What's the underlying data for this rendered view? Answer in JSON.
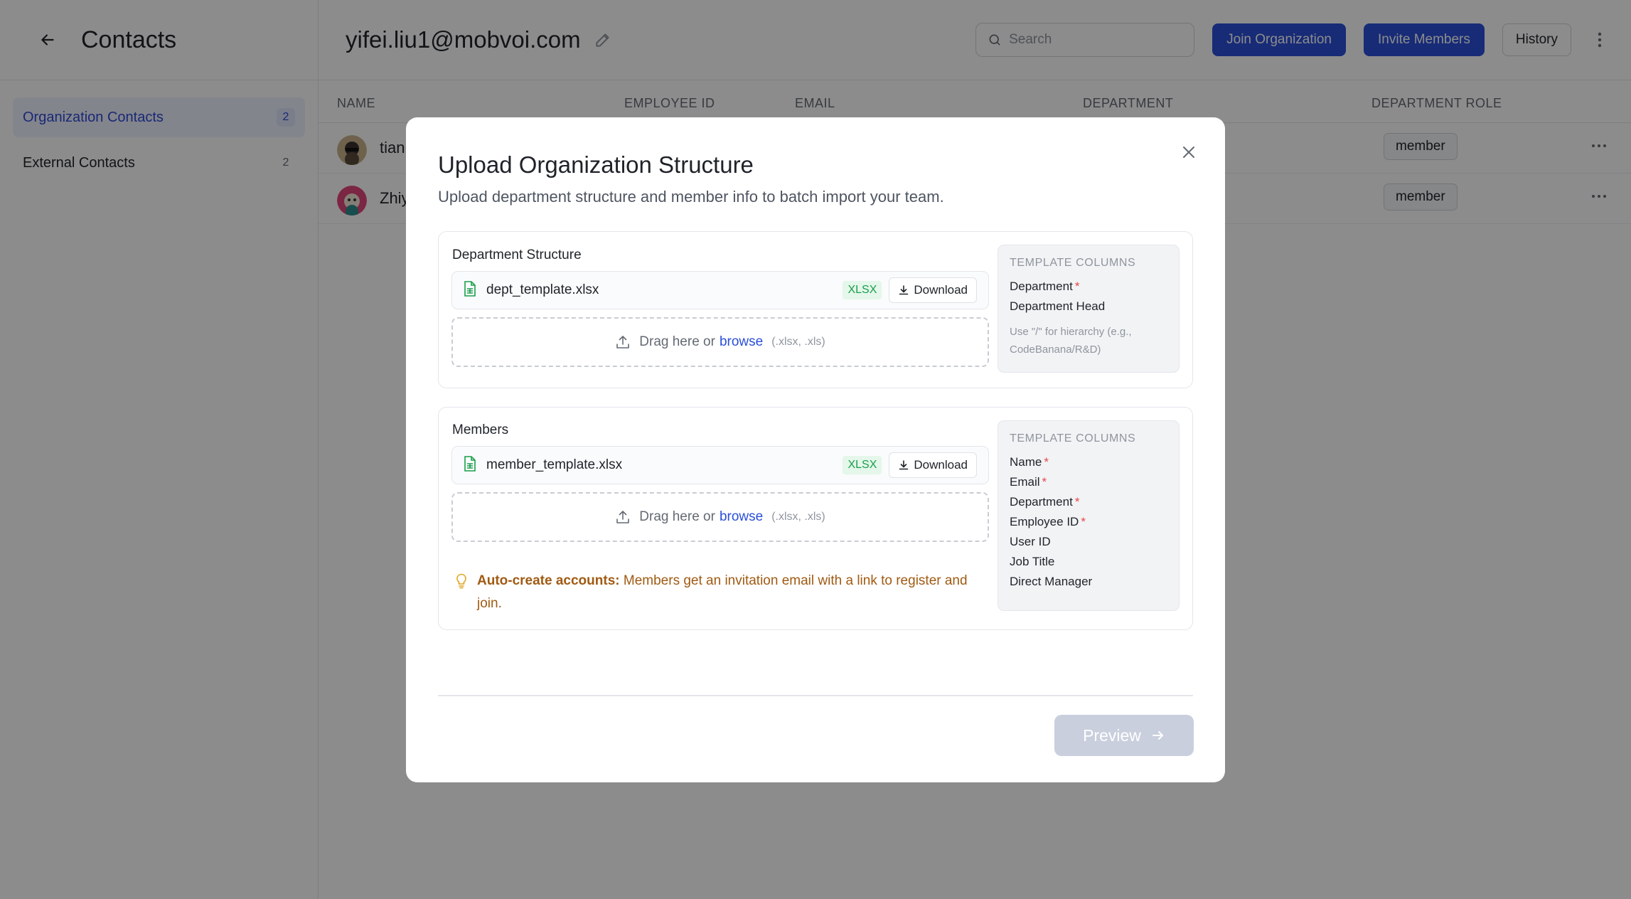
{
  "sidebar": {
    "title": "Contacts",
    "items": [
      {
        "label": "Organization Contacts",
        "count": "2",
        "active": true
      },
      {
        "label": "External Contacts",
        "count": "2",
        "active": false
      }
    ]
  },
  "header": {
    "org_name": "yifei.liu1@mobvoi.com",
    "search_placeholder": "Search",
    "join_label": "Join Organization",
    "invite_label": "Invite Members",
    "history_label": "History"
  },
  "table": {
    "columns": [
      "NAME",
      "EMPLOYEE ID",
      "EMAIL",
      "DEPARTMENT",
      "DEPARTMENT ROLE"
    ],
    "rows": [
      {
        "name": "tian",
        "role": "member"
      },
      {
        "name": "Zhiy",
        "role": "member"
      }
    ]
  },
  "modal": {
    "title": "Upload Organization Structure",
    "subtitle": "Upload department structure and member info to batch import your team.",
    "department": {
      "title": "Department Structure",
      "file_name": "dept_template.xlsx",
      "badge": "XLSX",
      "download_label": "Download",
      "dropzone_text": "Drag here or",
      "dropzone_browse": "browse",
      "dropzone_ext": "(.xlsx, .xls)",
      "columns_title": "TEMPLATE COLUMNS",
      "columns": [
        {
          "label": "Department",
          "required": "*"
        },
        {
          "label": "Department Head",
          "required": ""
        }
      ],
      "note": "Use \"/\" for hierarchy (e.g., CodeBanana/R&D)"
    },
    "members": {
      "title": "Members",
      "file_name": "member_template.xlsx",
      "badge": "XLSX",
      "download_label": "Download",
      "dropzone_text": "Drag here or",
      "dropzone_browse": "browse",
      "dropzone_ext": "(.xlsx, .xls)",
      "columns_title": "TEMPLATE COLUMNS",
      "columns": [
        {
          "label": "Name",
          "required": "*"
        },
        {
          "label": "Email",
          "required": "*"
        },
        {
          "label": "Department",
          "required": "*"
        },
        {
          "label": "Employee ID",
          "required": "*"
        },
        {
          "label": "User ID",
          "required": ""
        },
        {
          "label": "Job Title",
          "required": ""
        },
        {
          "label": "Direct Manager",
          "required": ""
        }
      ],
      "tip_bold": "Auto-create accounts:",
      "tip_text": "Members get an invitation email with a link to register and join."
    },
    "preview_label": "Preview"
  },
  "colors": {
    "accent": "#2b4fd9",
    "required": "#e5484d",
    "tip": "#a05a12",
    "xlsx_badge": "#1a9e4b"
  },
  "icons": [
    "arrow-left-icon",
    "pencil-icon",
    "search-icon",
    "more-vertical-icon",
    "more-horizontal-icon",
    "close-icon",
    "spreadsheet-file-icon",
    "download-icon",
    "upload-icon",
    "lightbulb-icon",
    "arrow-right-icon"
  ]
}
